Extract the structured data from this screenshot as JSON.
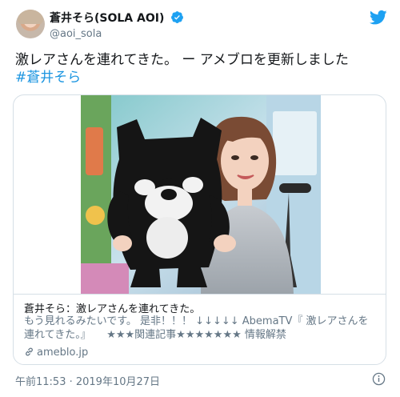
{
  "user": {
    "display_name": "蒼井そら(SOLA AOI)",
    "handle": "@aoi_sola"
  },
  "tweet": {
    "text": "激レアさんを連れてきた。 ー アメブロを更新しました",
    "hashtag": "#蒼井そら"
  },
  "card": {
    "title": "蒼井そら：激レアさんを連れてきた。",
    "description": "もう見れるみたいです。 是非！！！ ↓↓↓↓↓ AbemaTV『 激レアさんを連れてきた。』　　★★★関連記事★★★★★★★ 情報解禁",
    "link": "ameblo.jp"
  },
  "footer": {
    "timestamp": "午前11:53 · 2019年10月27日"
  },
  "colors": {
    "accent": "#1da1f2",
    "hashtag": "#1b95e0",
    "secondary_text": "#657786",
    "border": "#d6dfe6"
  },
  "icons": {
    "verified": "verified-badge-icon",
    "brand": "twitter-bird-icon",
    "link": "link-icon",
    "info": "info-icon"
  }
}
